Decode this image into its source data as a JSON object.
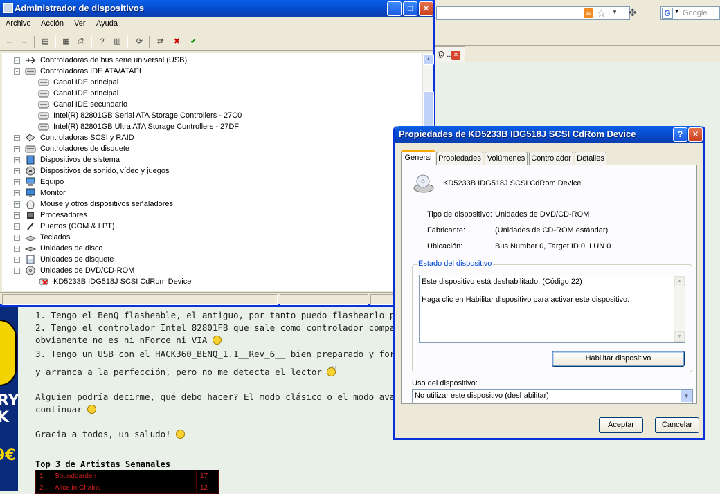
{
  "browser": {
    "google_placeholder": "Google",
    "google_letter": "G",
    "tab_label": "@ ..."
  },
  "device_manager": {
    "title": "Administrador de dispositivos",
    "menu": [
      "Archivo",
      "Acción",
      "Ver",
      "Ayuda"
    ],
    "tree": [
      {
        "label": "Controladoras de bus serie universal (USB)",
        "level": 1,
        "expander": "+",
        "icon": "usb-icon"
      },
      {
        "label": "Controladoras IDE ATA/ATAPI",
        "level": 1,
        "expander": "-",
        "icon": "ide-controller-icon"
      },
      {
        "label": "Canal IDE principal",
        "level": 2,
        "expander": "",
        "icon": "ide-channel-icon"
      },
      {
        "label": "Canal IDE principal",
        "level": 2,
        "expander": "",
        "icon": "ide-channel-icon"
      },
      {
        "label": "Canal IDE secundario",
        "level": 2,
        "expander": "",
        "icon": "ide-channel-icon"
      },
      {
        "label": "Intel(R) 82801GB Serial ATA Storage Controllers - 27C0",
        "level": 2,
        "expander": "",
        "icon": "ide-channel-icon"
      },
      {
        "label": "Intel(R) 82801GB Ultra ATA Storage Controllers - 27DF",
        "level": 2,
        "expander": "",
        "icon": "ide-channel-icon"
      },
      {
        "label": "Controladoras SCSI y RAID",
        "level": 1,
        "expander": "+",
        "icon": "scsi-icon"
      },
      {
        "label": "Controladores de disquete",
        "level": 1,
        "expander": "+",
        "icon": "floppy-controller-icon"
      },
      {
        "label": "Dispositivos de sistema",
        "level": 1,
        "expander": "+",
        "icon": "system-device-icon"
      },
      {
        "label": "Dispositivos de sonido, vídeo y juegos",
        "level": 1,
        "expander": "+",
        "icon": "sound-icon"
      },
      {
        "label": "Equipo",
        "level": 1,
        "expander": "+",
        "icon": "computer-icon"
      },
      {
        "label": "Monitor",
        "level": 1,
        "expander": "+",
        "icon": "monitor-icon"
      },
      {
        "label": "Mouse y otros dispositivos señaladores",
        "level": 1,
        "expander": "+",
        "icon": "mouse-icon"
      },
      {
        "label": "Procesadores",
        "level": 1,
        "expander": "+",
        "icon": "processor-icon"
      },
      {
        "label": "Puertos (COM & LPT)",
        "level": 1,
        "expander": "+",
        "icon": "port-icon"
      },
      {
        "label": "Teclados",
        "level": 1,
        "expander": "+",
        "icon": "keyboard-icon"
      },
      {
        "label": "Unidades de disco",
        "level": 1,
        "expander": "+",
        "icon": "disk-drive-icon"
      },
      {
        "label": "Unidades de disquete",
        "level": 1,
        "expander": "+",
        "icon": "floppy-drive-icon"
      },
      {
        "label": "Unidades de DVD/CD-ROM",
        "level": 1,
        "expander": "-",
        "icon": "cdrom-icon"
      },
      {
        "label": "KD5233B IDG518J SCSI CdRom Device",
        "level": 2,
        "expander": "",
        "icon": "cdrom-disabled-icon"
      }
    ]
  },
  "forum": {
    "lines": [
      "1. Tengo el BenQ flasheable, el antiguo, por tanto puedo flashearlo por softwa",
      "2. Tengo el controlador Intel 82801FB que sale como controlador compatible,",
      "obviamente no es ni nForce ni VIA",
      "3. Tengo un USB con el HACK360_BENQ_1.1__Rev_6__ bien preparado y forma",
      "y arranca a la perfección, pero no me detecta el lector",
      "Alguien podría decirme, qué debo hacer? El modo clásico o el modo avanzado?",
      "continuar",
      "Gracia a todos, un saludo!"
    ],
    "emoji_mark": "???",
    "banner_text": [
      "RY",
      "K"
    ],
    "banner_price": "9€",
    "top3_title": "Top 3 de Artistas Semanales",
    "top3_rows": [
      {
        "rank": "1",
        "artist": "Soundgarden",
        "plays": "17"
      },
      {
        "rank": "2",
        "artist": "Alice in Chains",
        "plays": "12"
      }
    ]
  },
  "properties": {
    "title": "Propiedades de KD5233B IDG518J SCSI CdRom Device",
    "tabs": [
      "General",
      "Propiedades",
      "Volúmenes",
      "Controlador",
      "Detalles"
    ],
    "device_name": "KD5233B IDG518J SCSI CdRom Device",
    "fields": [
      {
        "label": "Tipo de dispositivo:",
        "value": "Unidades de DVD/CD-ROM"
      },
      {
        "label": "Fabricante:",
        "value": "(Unidades de CD-ROM estándar)"
      },
      {
        "label": "Ubicación:",
        "value": "Bus Number 0, Target ID 0, LUN 0"
      }
    ],
    "status_group_title": "Estado del dispositivo",
    "status_lines": [
      "Este dispositivo está deshabilitado. (Código 22)",
      "Haga clic en Habilitar dispositivo para activar este dispositivo."
    ],
    "enable_button": "Habilitar dispositivo",
    "usage_label": "Uso del dispositivo:",
    "usage_value": "No utilizar este dispositivo (deshabilitar)",
    "ok_button": "Aceptar",
    "cancel_button": "Cancelar"
  }
}
